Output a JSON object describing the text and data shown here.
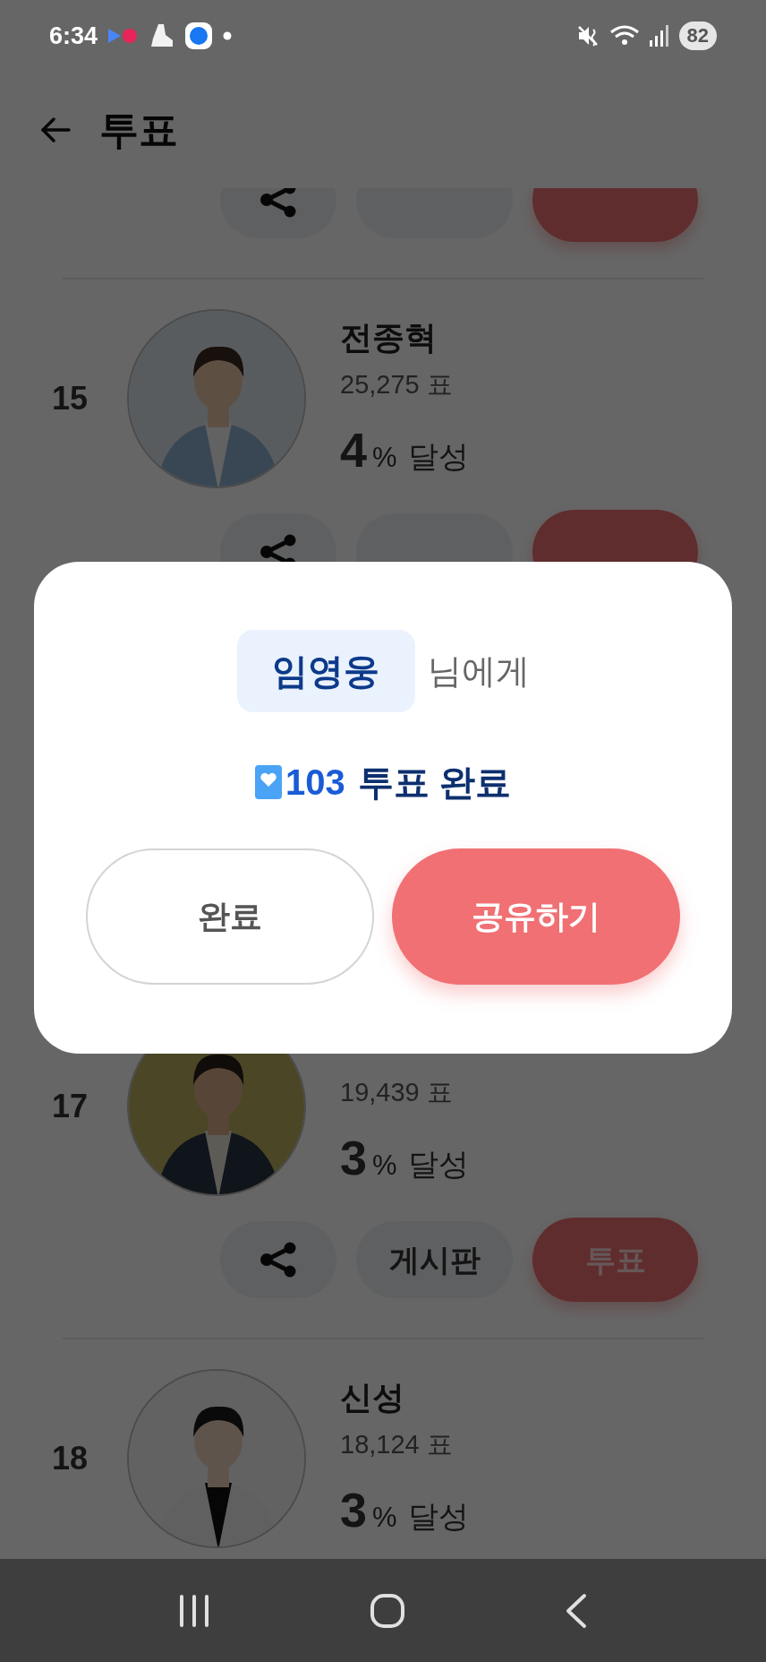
{
  "status_bar": {
    "time": "6:34",
    "battery": "82"
  },
  "header": {
    "title": "투표"
  },
  "list": {
    "top_actions": true,
    "rows": [
      {
        "rank": "15",
        "name": "전종혁",
        "votes": "25,275 표",
        "percent": "4",
        "percent_sign": "%",
        "achieved": "달성",
        "actions": true
      },
      {
        "rank": "17",
        "votes": "19,439 표",
        "percent": "3",
        "percent_sign": "%",
        "achieved": "달성",
        "actions": {
          "board": "게시판",
          "vote": "투표"
        }
      },
      {
        "rank": "18",
        "name": "신성",
        "votes": "18,124 표",
        "percent": "3",
        "percent_sign": "%",
        "achieved": "달성"
      }
    ]
  },
  "dialog": {
    "recipient": "임영웅",
    "recipient_suffix": "님에게",
    "vote_count": "103",
    "vote_label": "투표 완료",
    "buttons": [
      {
        "label": "완료",
        "kind": "secondary"
      },
      {
        "label": "공유하기",
        "kind": "primary"
      }
    ]
  }
}
